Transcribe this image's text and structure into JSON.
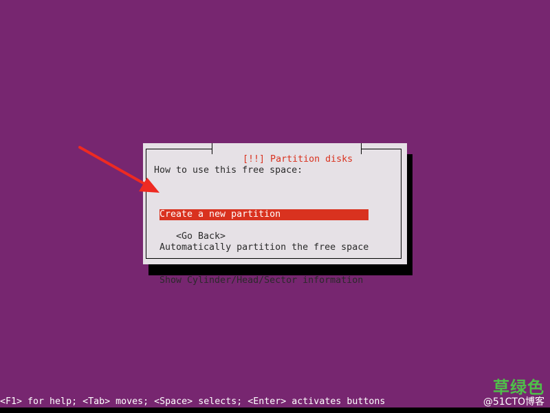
{
  "dialog": {
    "title": "[!!] Partition disks",
    "prompt": "How to use this free space:",
    "options": [
      "Create a new partition",
      "Automatically partition the free space",
      "Show Cylinder/Head/Sector information"
    ],
    "selected_index": 0,
    "back_button": "<Go Back>"
  },
  "status_bar": {
    "text": "<F1> for help; <Tab> moves; <Space> selects; <Enter> activates buttons"
  },
  "watermark": {
    "main": "草绿色",
    "sub": "@51CTO博客"
  },
  "colors": {
    "background": "#772670",
    "dialog_bg": "#e6e1e6",
    "accent": "#d9321f",
    "arrow": "#ee2a22"
  },
  "icons": {
    "annotation": "red-arrow-icon"
  }
}
